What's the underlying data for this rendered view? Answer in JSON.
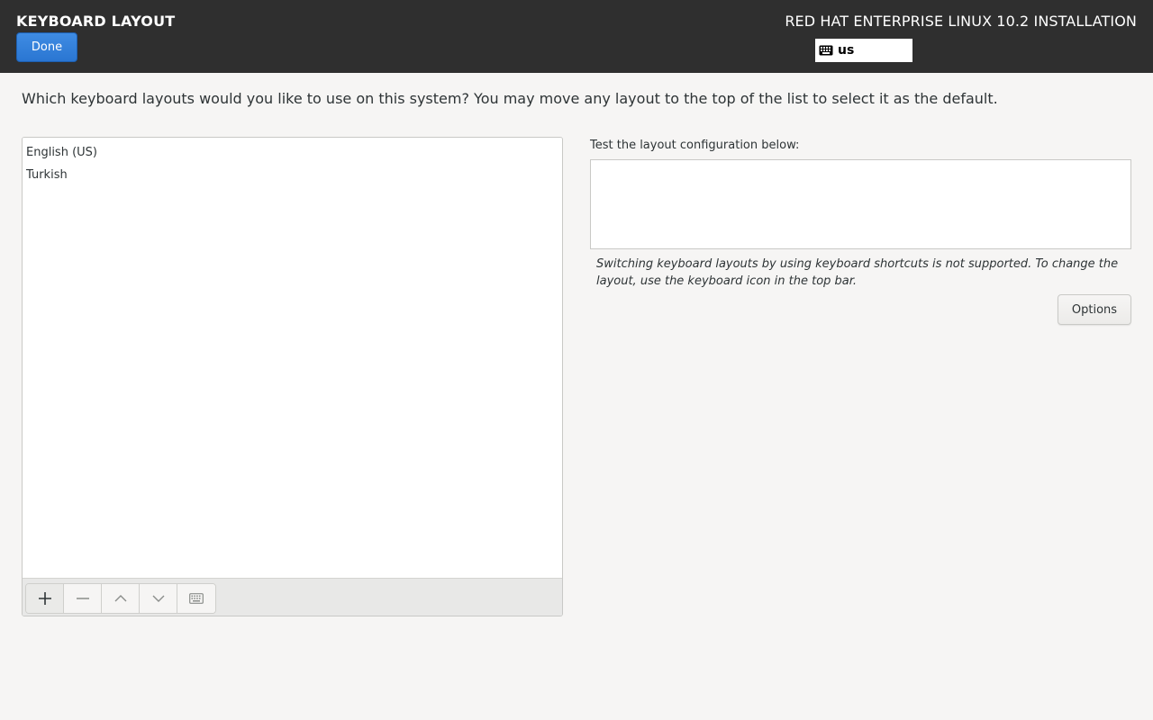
{
  "header": {
    "title": "KEYBOARD LAYOUT",
    "done_label": "Done",
    "product_title": "RED HAT ENTERPRISE LINUX 10.2 INSTALLATION",
    "keyboard_indicator": "us"
  },
  "intro_text": "Which keyboard layouts would you like to use on this system?  You may move any layout to the top of the list to select it as the default.",
  "layouts": {
    "items": [
      {
        "label": "English (US)"
      },
      {
        "label": "Turkish"
      }
    ]
  },
  "toolbar": {
    "buttons": [
      {
        "icon": "plus-icon"
      },
      {
        "icon": "minus-icon"
      },
      {
        "icon": "chevron-up-icon"
      },
      {
        "icon": "chevron-down-icon"
      },
      {
        "icon": "keyboard-icon"
      }
    ]
  },
  "test": {
    "label": "Test the layout configuration below:",
    "value": ""
  },
  "note": "Switching keyboard layouts by using keyboard shortcuts is not supported. To change the layout, use the keyboard icon in the top bar.",
  "options_label": "Options",
  "colors": {
    "header_bg": "#2f2f2f",
    "accent": "#2a76d2",
    "page_bg": "#f6f5f4"
  }
}
